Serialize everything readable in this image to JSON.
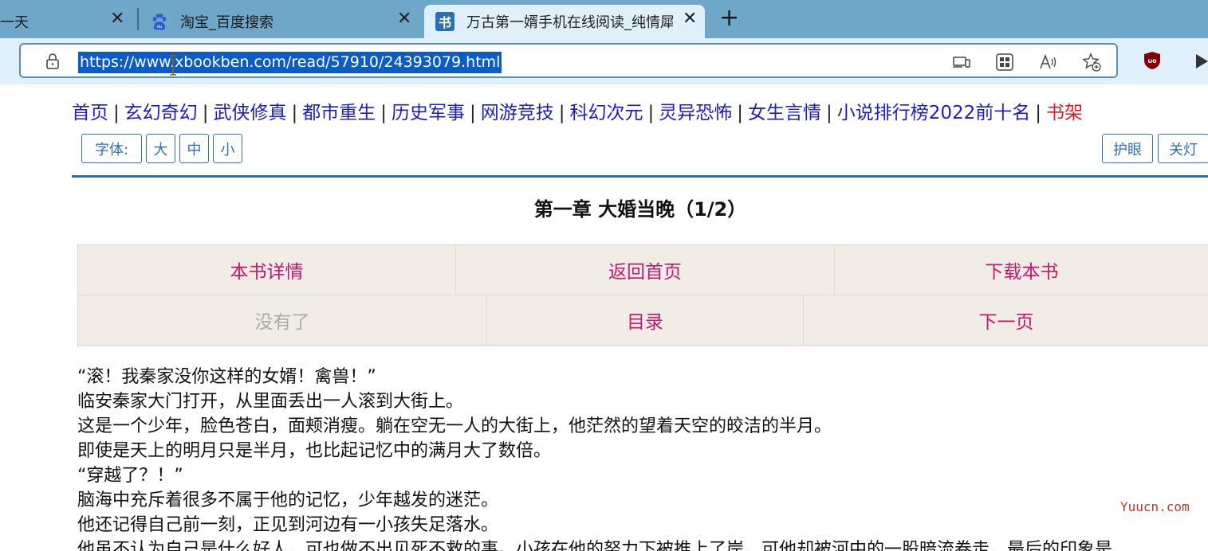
{
  "browser": {
    "tabs": [
      {
        "title": "一天"
      },
      {
        "title": "淘宝_百度搜索"
      },
      {
        "title": "万古第一婿手机在线阅读_纯情犀",
        "active": true
      }
    ],
    "address_bar": {
      "url": "https://www.xbookben.com/read/57910/24393079.html"
    },
    "toolbar_icons": [
      "devices-icon",
      "tab-grid-icon",
      "read-aloud-icon",
      "add-favorite-icon",
      "ublock-icon",
      "play-icon"
    ]
  },
  "site_nav": {
    "items": [
      {
        "label": "首页"
      },
      {
        "label": "玄幻奇幻"
      },
      {
        "label": "武侠修真"
      },
      {
        "label": "都市重生"
      },
      {
        "label": "历史军事"
      },
      {
        "label": "网游竞技"
      },
      {
        "label": "科幻次元"
      },
      {
        "label": "灵异恐怖"
      },
      {
        "label": "女生言情"
      },
      {
        "label": "小说排行榜2022前十名"
      },
      {
        "label": "书架"
      }
    ],
    "separator": "|"
  },
  "font_controls": {
    "label": "字体:",
    "large": "大",
    "medium": "中",
    "small": "小",
    "eye_care": "护眼",
    "lights_off": "关灯"
  },
  "chapter": {
    "title": "第一章 大婚当晚（1/2）"
  },
  "chapter_nav": {
    "row1": [
      "本书详情",
      "返回首页",
      "下载本书"
    ],
    "row2": [
      "没有了",
      "目录",
      "下一页"
    ]
  },
  "content": {
    "paragraphs": [
      "“滚！我秦家没你这样的女婿！禽兽！”",
      "临安秦家大门打开，从里面丢出一人滚到大街上。",
      "这是一个少年，脸色苍白，面颊消瘦。躺在空无一人的大街上，他茫然的望着天空的皎洁的半月。",
      "即使是天上的明月只是半月，也比起记忆中的满月大了数倍。",
      "“穿越了？！”",
      "脑海中充斥着很多不属于他的记忆，少年越发的迷茫。",
      "他还记得自己前一刻，正见到河边有一小孩失足落水。",
      "他虽不认为自己是什么好人，可也做不出见死不救的事。小孩在他的努力下被推上了岸，可他却被河中的一股暗流卷走，最后的印象是"
    ]
  },
  "watermark": "Yuucn.com"
}
